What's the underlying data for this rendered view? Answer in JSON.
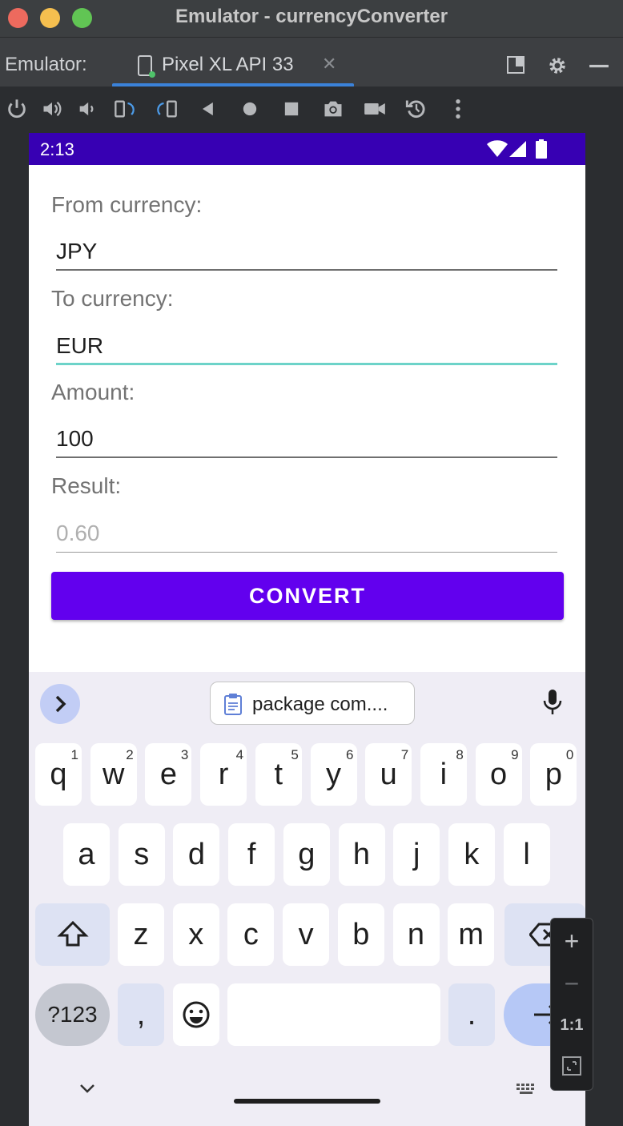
{
  "window": {
    "title": "Emulator - currencyConverter"
  },
  "tabbar": {
    "label": "Emulator:",
    "tab_name": "Pixel XL API 33",
    "close_glyph": "✕"
  },
  "toolbar_icons": [
    "power-icon",
    "volume-up-icon",
    "volume-down-icon",
    "rotate-left-icon",
    "rotate-right-icon",
    "back-icon",
    "home-icon",
    "overview-icon",
    "screenshot-icon",
    "screen-record-icon",
    "snapshot-icon",
    "more-icon"
  ],
  "status": {
    "time": "2:13"
  },
  "form": {
    "from_label": "From currency:",
    "from_value": "JPY",
    "to_label": "To currency:",
    "to_value": "EUR",
    "amount_label": "Amount:",
    "amount_value": "100",
    "result_label": "Result:",
    "result_placeholder": "0.60",
    "convert_button": "CONVERT"
  },
  "colors": {
    "status_bar": "#3700b3",
    "button": "#6200ee",
    "focus_underline": "#6dd3c9",
    "keyboard_bg": "#efedf5"
  },
  "keyboard": {
    "clipboard_suggestion": "package com....",
    "row1": [
      "q",
      "w",
      "e",
      "r",
      "t",
      "y",
      "u",
      "i",
      "o",
      "p"
    ],
    "row1_hints": [
      "1",
      "2",
      "3",
      "4",
      "5",
      "6",
      "7",
      "8",
      "9",
      "0"
    ],
    "row2": [
      "a",
      "s",
      "d",
      "f",
      "g",
      "h",
      "j",
      "k",
      "l"
    ],
    "row3": [
      "z",
      "x",
      "c",
      "v",
      "b",
      "n",
      "m"
    ],
    "symbols_key": "?123",
    "comma_key": ",",
    "period_key": "."
  },
  "zoom": {
    "plus": "+",
    "minus": "−",
    "one_to_one": "1:1"
  }
}
